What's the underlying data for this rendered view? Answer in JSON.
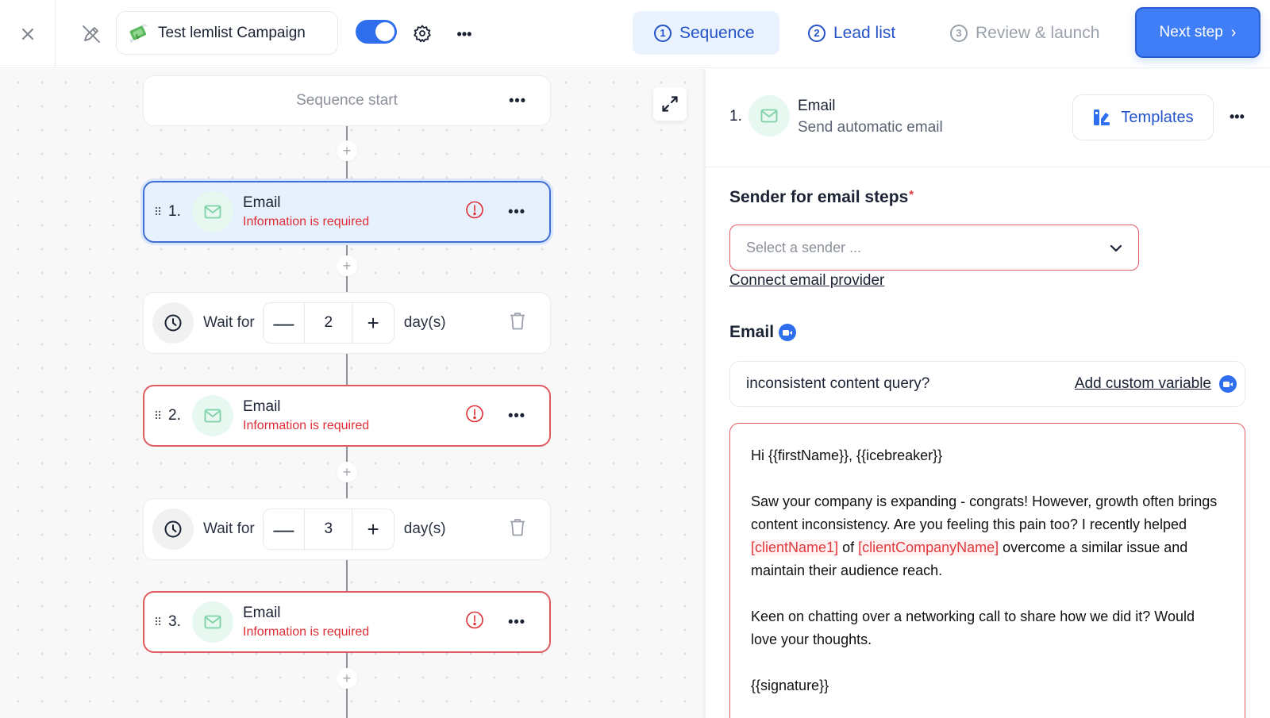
{
  "topbar": {
    "close_icon": "close-icon",
    "rename_icon": "pencil-off-icon",
    "campaign_emoji": "money-with-wings-emoji",
    "campaign_name": "Test lemlist Campaign",
    "toggle_on": true,
    "settings_icon": "gear-icon",
    "more_icon": "more-horizontal-icon",
    "steps": [
      {
        "num": "1",
        "label": "Sequence",
        "state": "active"
      },
      {
        "num": "2",
        "label": "Lead list",
        "state": "enabled"
      },
      {
        "num": "3",
        "label": "Review & launch",
        "state": "disabled"
      }
    ],
    "next_label": "Next step",
    "colors": {
      "accent": "#3f7ef6",
      "active_tab_bg": "#eaf2fd",
      "tab_text": "#2453c9"
    }
  },
  "canvas": {
    "start_label": "Sequence start",
    "expand_icon": "expand-icon",
    "steps": [
      {
        "type": "email",
        "num": "1.",
        "title": "Email",
        "subtitle": "Information is required",
        "state": "active"
      },
      {
        "type": "wait",
        "label": "Wait for",
        "value": "2",
        "unit": "day(s)"
      },
      {
        "type": "email",
        "num": "2.",
        "title": "Email",
        "subtitle": "Information is required",
        "state": "error"
      },
      {
        "type": "wait",
        "label": "Wait for",
        "value": "3",
        "unit": "day(s)"
      },
      {
        "type": "email",
        "num": "3.",
        "title": "Email",
        "subtitle": "Information is required",
        "state": "error"
      }
    ],
    "add_step_symbol": "+",
    "minus_symbol": "—",
    "plus_symbol": "+",
    "colors": {
      "error": "#df2f36",
      "active_border": "#3f6fd0",
      "mail_icon": "#7fd1a8"
    }
  },
  "panel": {
    "step_num": "1.",
    "step_title": "Email",
    "step_subtitle": "Send automatic email",
    "templates_label": "Templates",
    "sender_label": "Sender for email steps",
    "required_mark": "*",
    "sender_placeholder": "Select a sender ...",
    "connect_link": "Connect email provider",
    "email_label": "Email",
    "subject_value": "inconsistent content query?",
    "custom_variable_link": "Add custom variable",
    "body": {
      "greeting": "Hi {{firstName}}, {{icebreaker}}",
      "p1_a": "Saw your company is expanding - congrats! However, growth often brings content inconsistency. Are you feeling this pain too? I recently helped ",
      "p1_var1": "[clientName1]",
      "p1_b": " of ",
      "p1_var2": "[clientCompanyName]",
      "p1_c": " overcome a similar issue and maintain their audience reach.",
      "p2": "Keen on chatting over a networking call to share how we did it? Would love your thoughts.",
      "signature": "{{signature}}"
    }
  }
}
